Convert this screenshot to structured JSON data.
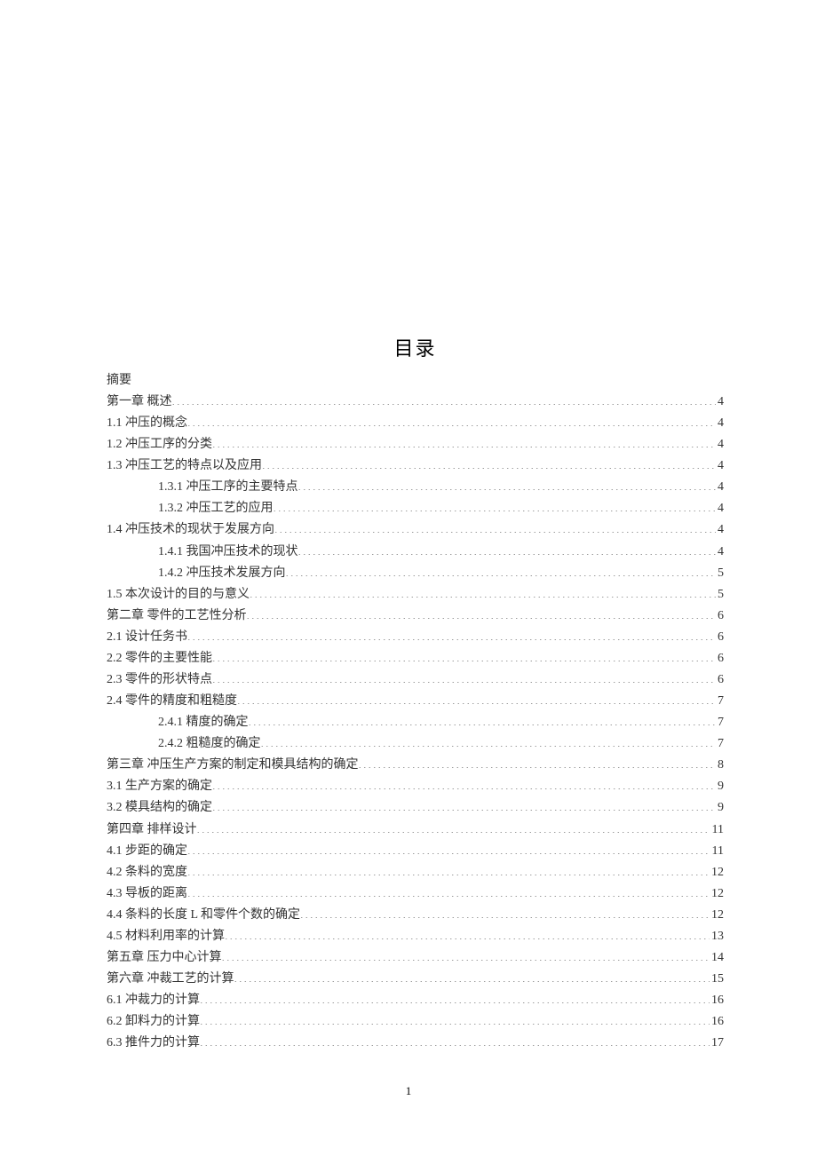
{
  "title": "目录",
  "abstract": "摘要",
  "page_number": "1",
  "toc": [
    {
      "label": "第一章  概述",
      "page": "4",
      "indent": 0
    },
    {
      "label": "1.1 冲压的概念",
      "page": "4",
      "indent": 0
    },
    {
      "label": "1.2 冲压工序的分类",
      "page": "4",
      "indent": 0
    },
    {
      "label": "1.3 冲压工艺的特点以及应用",
      "page": "4",
      "indent": 0
    },
    {
      "label": "1.3.1  冲压工序的主要特点",
      "page": "4",
      "indent": 1
    },
    {
      "label": "1.3.2  冲压工艺的应用",
      "page": "4",
      "indent": 1
    },
    {
      "label": "1.4 冲压技术的现状于发展方向",
      "page": "4",
      "indent": 0
    },
    {
      "label": "1.4.1  我国冲压技术的现状",
      "page": "4",
      "indent": 1
    },
    {
      "label": "1.4.2  冲压技术发展方向",
      "page": "5",
      "indent": 1
    },
    {
      "label": "1.5 本次设计的目的与意义",
      "page": "5",
      "indent": 0
    },
    {
      "label": "第二章  零件的工艺性分析",
      "page": "6",
      "indent": 0
    },
    {
      "label": "2.1 设计任务书",
      "page": "6",
      "indent": 0
    },
    {
      "label": "2.2 零件的主要性能",
      "page": "6",
      "indent": 0
    },
    {
      "label": "2.3 零件的形状特点",
      "page": "6",
      "indent": 0
    },
    {
      "label": "2.4 零件的精度和粗糙度",
      "page": "7",
      "indent": 0
    },
    {
      "label": "2.4.1  精度的确定",
      "page": "7",
      "indent": 1
    },
    {
      "label": "2.4.2  粗糙度的确定",
      "page": "7",
      "indent": 1
    },
    {
      "label": "第三章  冲压生产方案的制定和模具结构的确定",
      "page": "8",
      "indent": 0
    },
    {
      "label": "3.1  生产方案的确定",
      "page": "9",
      "indent": 0
    },
    {
      "label": "3.2  模具结构的确定",
      "page": "9",
      "indent": 0
    },
    {
      "label": "第四章  排样设计",
      "page": "11",
      "indent": 0
    },
    {
      "label": "4.1  步距的确定",
      "page": "11",
      "indent": 0
    },
    {
      "label": "4.2  条料的宽度",
      "page": "12",
      "indent": 0
    },
    {
      "label": "4.3  导板的距离",
      "page": "12",
      "indent": 0
    },
    {
      "label": "4.4  条料的长度 L 和零件个数的确定",
      "page": "12",
      "indent": 0
    },
    {
      "label": "4.5  材料利用率的计算",
      "page": "13",
      "indent": 0
    },
    {
      "label": "第五章  压力中心计算",
      "page": "14",
      "indent": 0
    },
    {
      "label": "第六章  冲裁工艺的计算",
      "page": "15",
      "indent": 0
    },
    {
      "label": "6.1  冲裁力的计算",
      "page": "16",
      "indent": 0
    },
    {
      "label": "6.2  卸料力的计算",
      "page": "16",
      "indent": 0
    },
    {
      "label": "6.3  推件力的计算",
      "page": "17",
      "indent": 0
    }
  ]
}
